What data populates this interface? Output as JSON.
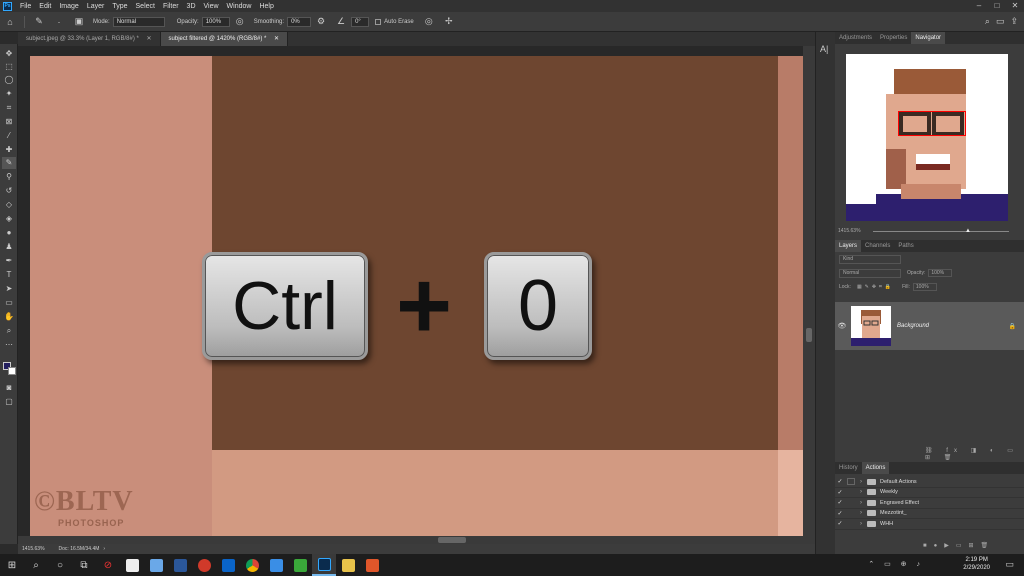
{
  "app": {
    "logo_text": "Ps"
  },
  "menu": [
    "File",
    "Edit",
    "Image",
    "Layer",
    "Type",
    "Select",
    "Filter",
    "3D",
    "View",
    "Window",
    "Help"
  ],
  "options": {
    "mode_label": "Mode:",
    "mode_value": "Normal",
    "opacity_label": "Opacity:",
    "opacity_value": "100%",
    "smoothing_label": "Smoothing:",
    "smoothing_value": "0%",
    "angle_value": "0°",
    "auto_erase_label": "Auto Erase"
  },
  "tabs": [
    {
      "label": "subject.jpeg @ 33.3% (Layer 1, RGB/8#) *",
      "active": false
    },
    {
      "label": "subject filtered @ 1420% (RGB/8#) *",
      "active": true
    }
  ],
  "canvas": {
    "key1": "Ctrl",
    "plus": "+",
    "key2": "0",
    "watermark_main": "©BLTV",
    "watermark_sub": "PHOTOSHOP",
    "colors": {
      "left": "#c98e7b",
      "main": "#6e4630",
      "bottom": "#d29a82",
      "right": "#b87c68",
      "far_right": "#e6b49f"
    }
  },
  "status": {
    "zoom": "1415.63%",
    "doc": "Doc: 16.5M/34.4M"
  },
  "top_panel": {
    "tabs": [
      "Adjustments",
      "Properties",
      "Navigator"
    ],
    "active": "Navigator",
    "zoom": "1415.63%"
  },
  "layers_panel": {
    "tabs": [
      "Layers",
      "Channels",
      "Paths"
    ],
    "kind_placeholder": "Kind",
    "blend": "Normal",
    "opacity_label": "Opacity:",
    "opacity_value": "100%",
    "lock_label": "Lock:",
    "fill_label": "Fill:",
    "fill_value": "100%",
    "layer_name": "Background"
  },
  "actions_panel": {
    "tabs": [
      "History",
      "Actions"
    ],
    "items": [
      "Default Actions",
      "Weekly",
      "Engraved Effect",
      "Mezzotint_",
      "WHH"
    ]
  },
  "taskbar": {
    "time": "2:19 PM",
    "date": "2/29/2020"
  }
}
